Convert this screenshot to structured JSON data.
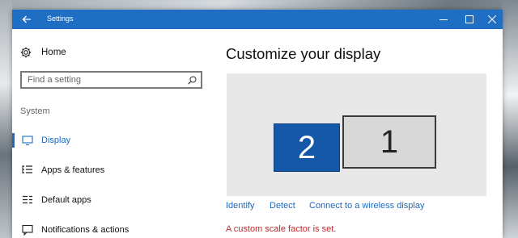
{
  "window": {
    "title": "Settings"
  },
  "sidebar": {
    "home_label": "Home",
    "search_placeholder": "Find a setting",
    "group_label": "System",
    "items": [
      {
        "label": "Display",
        "icon": "monitor-icon",
        "active": true
      },
      {
        "label": "Apps & features",
        "icon": "apps-list-icon",
        "active": false
      },
      {
        "label": "Default apps",
        "icon": "default-apps-icon",
        "active": false
      },
      {
        "label": "Notifications & actions",
        "icon": "notification-icon",
        "active": false
      }
    ]
  },
  "main": {
    "title": "Customize your display",
    "monitors": [
      {
        "number": "2",
        "selected": true
      },
      {
        "number": "1",
        "selected": false
      }
    ],
    "links": {
      "identify": "Identify",
      "detect": "Detect",
      "wireless": "Connect to a wireless display"
    },
    "warning": "A custom scale factor is set."
  },
  "colors": {
    "accent": "#1b6ac0",
    "titlebar": "#1e6fc4",
    "warning": "#c0282d",
    "selected_monitor": "#1558a8"
  }
}
